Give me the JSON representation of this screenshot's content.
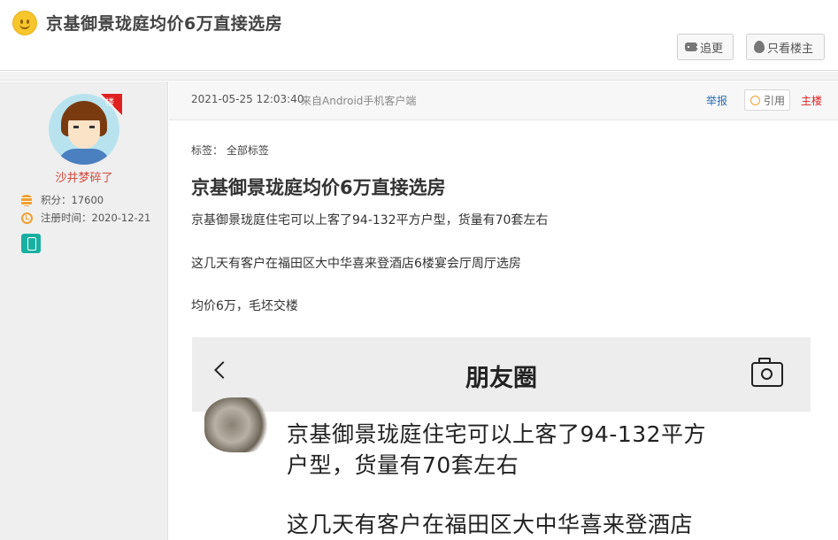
{
  "header": {
    "title": "京基御景珑庭均价6万直接选房",
    "follow_label": "追更",
    "owner_only_label": "只看楼主"
  },
  "author": {
    "floor_badge": "楼",
    "name": "沙井梦碎了",
    "points": "积分：17600",
    "registered": "注册时间：2020-12-21"
  },
  "post": {
    "time": "2021-05-25 12:03:40",
    "source": "来自Android手机客户端",
    "report_label": "举报",
    "quote_label": "引用",
    "floor_label": "主楼",
    "tags": "标签：  全部标签",
    "title": "京基御景珑庭均价6万直接选房",
    "paragraphs": [
      "京基御景珑庭住宅可以上客了94-132平方户型，货量有70套左右",
      "这几天有客户在福田区大中华喜来登酒店6楼宴会厅周厅选房",
      "均价6万，毛坯交楼"
    ]
  },
  "embedded_screenshot": {
    "nav_title": "朋友圈",
    "lines": [
      "京基御景珑庭住宅可以上客了94-132平方",
      "户型，货量有70套左右",
      "这几天有客户在福田区大中华喜来登酒店"
    ]
  },
  "colors": {
    "username": "#d24a3c",
    "report_link": "#2a6db0",
    "main_floor": "#d22222",
    "phone_badge": "#18b0a0"
  }
}
